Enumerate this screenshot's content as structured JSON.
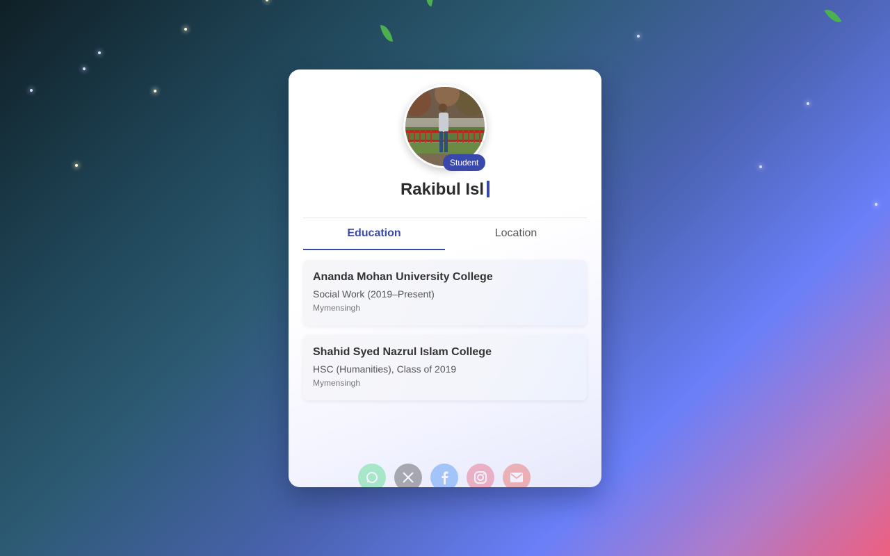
{
  "profile": {
    "badge": "Student",
    "name_typed": "Rakibul Isl"
  },
  "tabs": [
    {
      "label": "Education",
      "active": true
    },
    {
      "label": "Location",
      "active": false
    }
  ],
  "education": [
    {
      "institution": "Ananda Mohan University College",
      "program": "Social Work (2019–Present)",
      "location": "Mymensingh"
    },
    {
      "institution": "Shahid Syed Nazrul Islam College",
      "program": "HSC (Humanities), Class of 2019",
      "location": "Mymensingh"
    }
  ],
  "socials": [
    {
      "icon": "whatsapp-icon",
      "color": "#25d366",
      "glyph": "☏"
    },
    {
      "icon": "x-icon",
      "color": "#222222",
      "glyph": "X"
    },
    {
      "icon": "facebook-icon",
      "color": "#1877f2",
      "glyph": "f"
    },
    {
      "icon": "instagram-icon",
      "color": "#e4405f",
      "glyph": "◎"
    },
    {
      "icon": "mail-icon",
      "color": "#ea4335",
      "glyph": "✉"
    }
  ],
  "colors": {
    "accent": "#3949ab",
    "leaf": "#4caf50"
  }
}
